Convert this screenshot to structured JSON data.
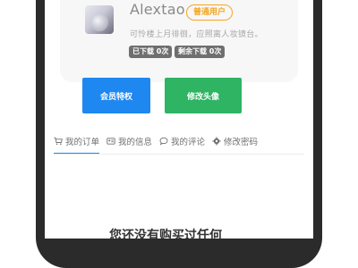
{
  "user": {
    "name": "Alextao",
    "level_badge": "普通用户",
    "bio": "可怜楼上月徘徊，应照离人妆镜台。",
    "stats": [
      {
        "label": "已下载 0次"
      },
      {
        "label": "剩余下载 0次"
      }
    ]
  },
  "actions": {
    "vip_label": "会员特权",
    "change_avatar_label": "修改头像"
  },
  "tabs": [
    {
      "label": "我的订单",
      "icon": "cart-icon",
      "active": true
    },
    {
      "label": "我的信息",
      "icon": "id-card-icon",
      "active": false
    },
    {
      "label": "我的评论",
      "icon": "comment-icon",
      "active": false
    },
    {
      "label": "修改密码",
      "icon": "gear-icon",
      "active": false
    }
  ],
  "orders": {
    "empty_text": "您还没有购买过任何"
  },
  "colors": {
    "accent_blue": "#1e88f0",
    "accent_green": "#2eb463",
    "badge_orange": "#f5a623",
    "phone_frame": "#2b2b2b"
  }
}
